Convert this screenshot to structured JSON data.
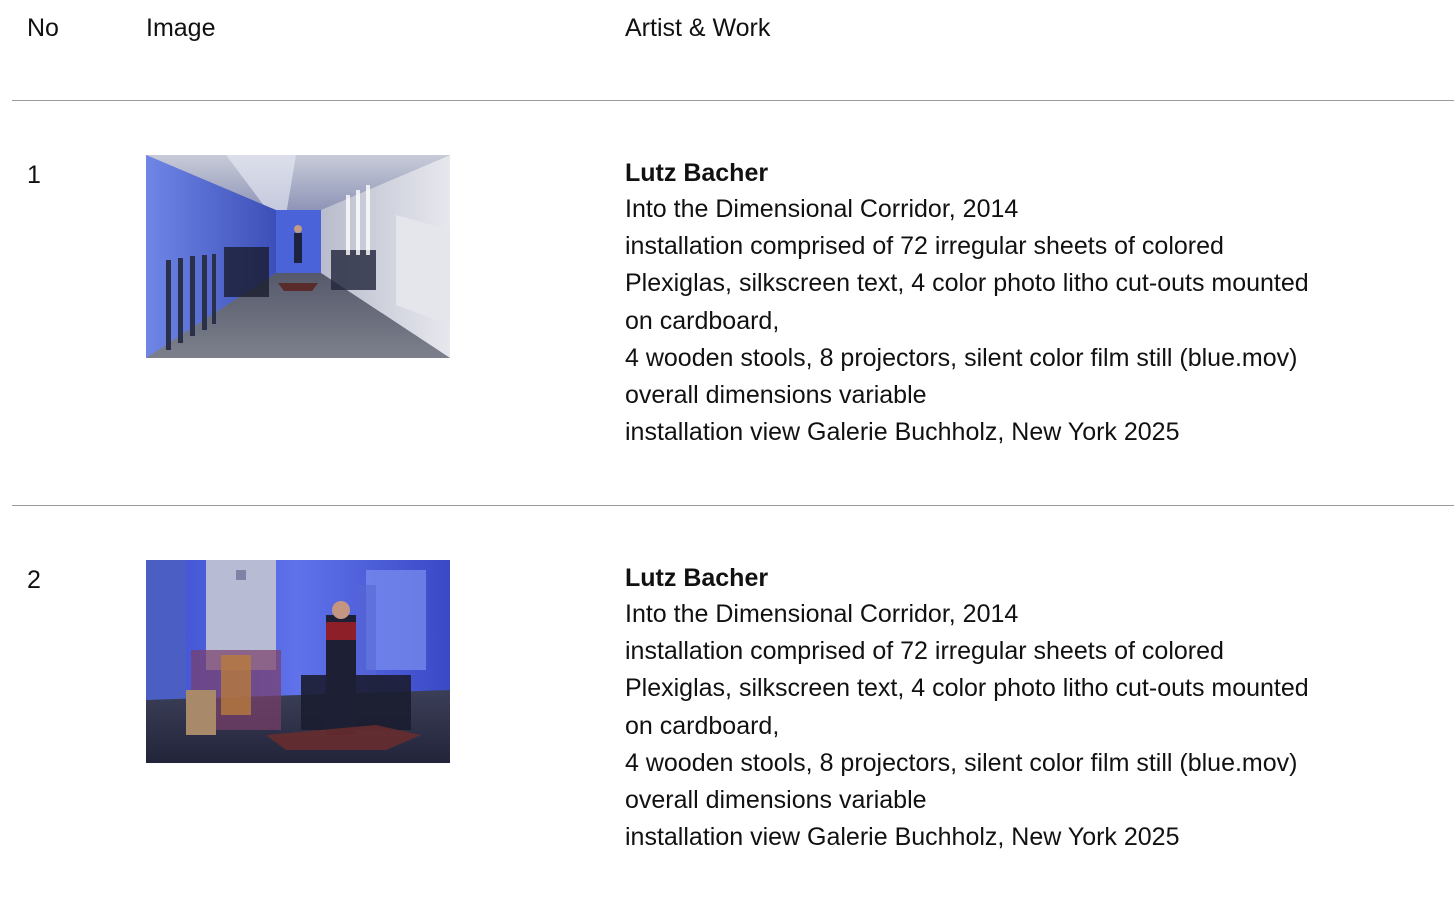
{
  "header": {
    "no_label": "No",
    "image_label": "Image",
    "artist_label": "Artist & Work"
  },
  "rows": [
    {
      "no": "1",
      "image_icon": "installation-photo-corridor",
      "artist": "Lutz Bacher",
      "lines": [
        "Into the Dimensional Corridor, 2014",
        "installation comprised of 72 irregular sheets of colored",
        "Plexiglas, silkscreen text, 4 color photo litho cut-outs mounted",
        "on cardboard,",
        "4 wooden stools, 8 projectors, silent color film still (blue.mov)",
        "overall dimensions variable",
        "installation view Galerie Buchholz, New York 2025"
      ]
    },
    {
      "no": "2",
      "image_icon": "installation-photo-figure-cutout",
      "artist": "Lutz Bacher",
      "lines": [
        "Into the Dimensional Corridor, 2014",
        "installation comprised of 72 irregular sheets of colored",
        "Plexiglas, silkscreen text, 4 color photo litho cut-outs mounted",
        "on cardboard,",
        "4 wooden stools, 8 projectors, silent color film still (blue.mov)",
        "overall dimensions variable",
        "installation view Galerie Buchholz, New York 2025"
      ]
    }
  ]
}
